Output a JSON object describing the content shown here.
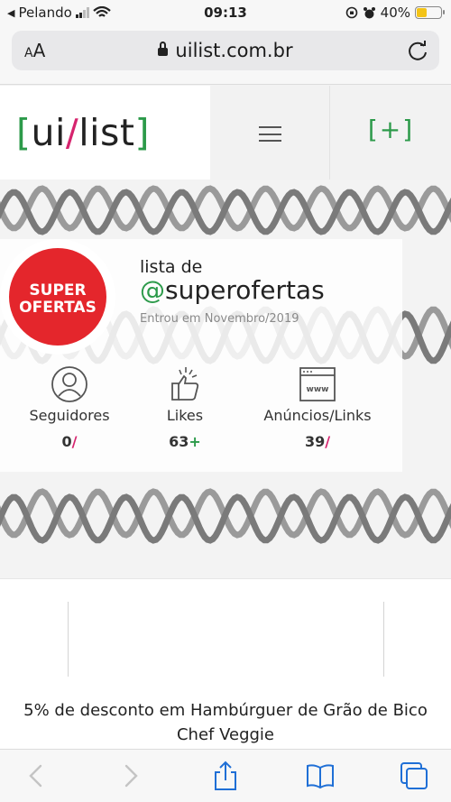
{
  "status_bar": {
    "carrier": "Pelando",
    "time": "09:13",
    "battery": "40%"
  },
  "browser": {
    "text_size_label": "AA",
    "url": "uilist.com.br"
  },
  "header": {
    "logo": {
      "open": "[",
      "ui": "ui",
      "slash": "/",
      "list": "list",
      "close": "]"
    },
    "add_label": "[+]"
  },
  "profile": {
    "avatar_line1": "SUPER",
    "avatar_line2": "OFERTAS",
    "list_prefix": "lista de",
    "handle_at": "@",
    "handle_name": "superofertas",
    "joined": "Entrou em Novembro/2019",
    "stats": {
      "followers": {
        "label": "Seguidores",
        "value": "0",
        "suffix": "/"
      },
      "likes": {
        "label": "Likes",
        "value": "63",
        "suffix": "+"
      },
      "links": {
        "label": "Anúncios/Links",
        "value": "39",
        "suffix": "/"
      }
    }
  },
  "listing": {
    "title": "5% de desconto em Hambúrguer de Grão de Bico Chef Veggie"
  },
  "colors": {
    "brand_green": "#2c9a4a",
    "brand_pink": "#d6246e",
    "avatar_red": "#e4262c",
    "battery_yellow": "#f3c317"
  },
  "icons": [
    "back-icon",
    "forward-icon",
    "share-icon",
    "bookmarks-icon",
    "tabs-icon",
    "user-icon",
    "thumbs-up-icon",
    "www-icon",
    "reload-icon",
    "lock-icon",
    "menu-icon"
  ]
}
